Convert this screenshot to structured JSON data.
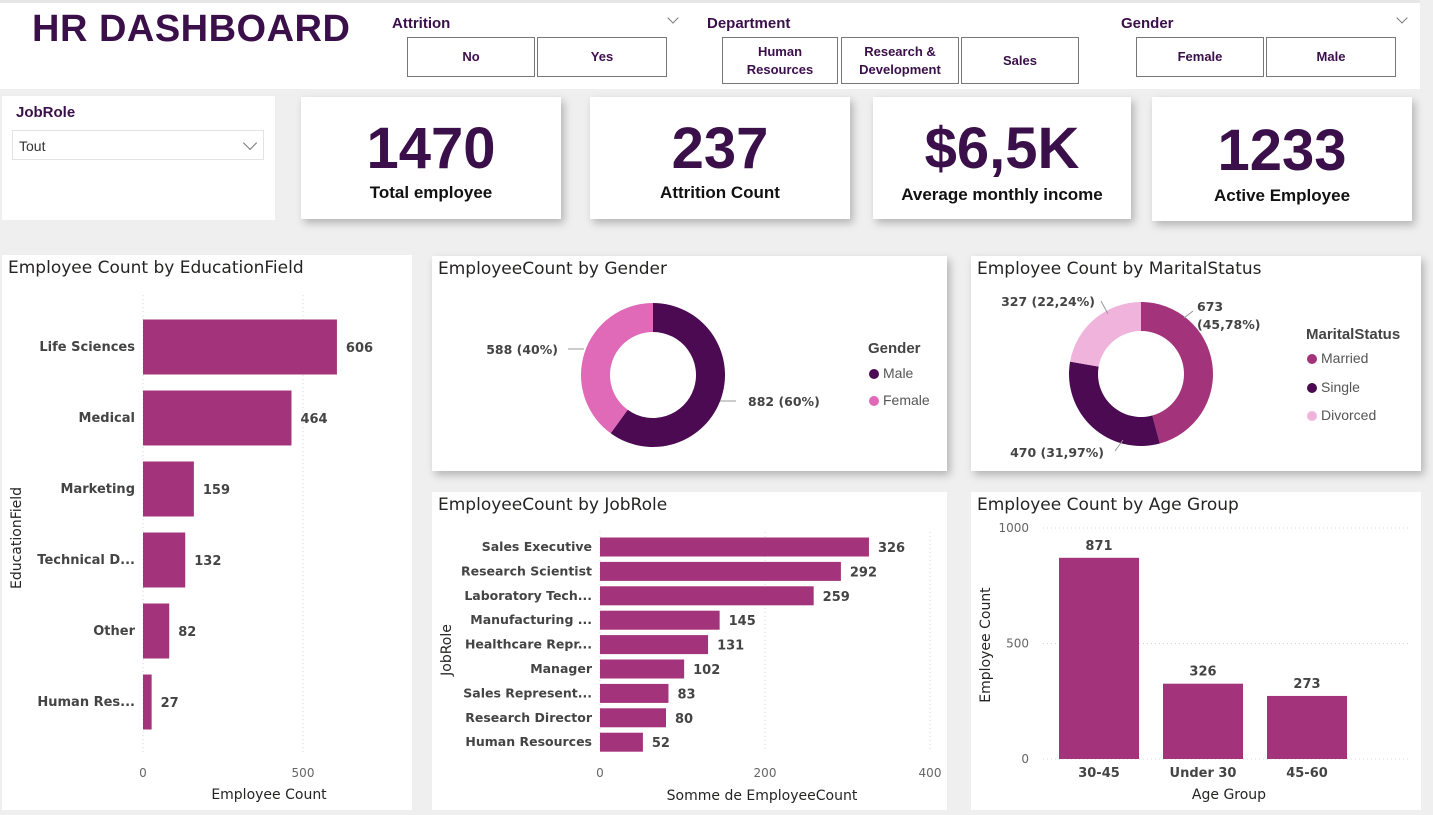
{
  "header": {
    "title": "HR DASHBOARD"
  },
  "filters": {
    "attrition": {
      "label": "Attrition",
      "options": [
        "No",
        "Yes"
      ]
    },
    "department": {
      "label": "Department",
      "options": [
        "Human Resources",
        "Research & Development",
        "Sales"
      ]
    },
    "gender": {
      "label": "Gender",
      "options": [
        "Female",
        "Male"
      ]
    },
    "jobrole": {
      "label": "JobRole",
      "selected": "Tout"
    }
  },
  "kpis": [
    {
      "value": "1470",
      "label": "Total employee"
    },
    {
      "value": "237",
      "label": "Attrition Count"
    },
    {
      "value": "$6,5K",
      "label": "Average monthly income"
    },
    {
      "value": "1233",
      "label": "Active Employee"
    }
  ],
  "colors": {
    "primary": "#a3337a",
    "dark_purple": "#4b0a52",
    "pink": "#e06ab7",
    "light_pink": "#efb3dc",
    "title_purple": "#3a0f4a"
  },
  "chart_data": [
    {
      "type": "bar",
      "orientation": "horizontal",
      "title": "Employee Count by EducationField",
      "xlabel": "Employee Count",
      "ylabel": "EducationField",
      "categories": [
        "Life Sciences",
        "Medical",
        "Marketing",
        "Technical D...",
        "Other",
        "Human Res..."
      ],
      "values": [
        606,
        464,
        159,
        132,
        82,
        27
      ],
      "xticks": [
        "0",
        "500"
      ],
      "xlim": [
        0,
        750
      ]
    },
    {
      "type": "pie",
      "variant": "donut",
      "title": "EmployeeCount by Gender",
      "legend_title": "Gender",
      "slices": [
        {
          "name": "Male",
          "value": 882,
          "label": "882 (60%)",
          "color": "#4b0a52"
        },
        {
          "name": "Female",
          "value": 588,
          "label": "588 (40%)",
          "color": "#e06ab7"
        }
      ]
    },
    {
      "type": "pie",
      "variant": "donut",
      "title": "Employee Count by MaritalStatus",
      "legend_title": "MaritalStatus",
      "slices": [
        {
          "name": "Married",
          "value": 673,
          "label_lines": [
            "673",
            "(45,78%)"
          ],
          "color": "#a3337a"
        },
        {
          "name": "Single",
          "value": 470,
          "label_lines": [
            "470 (31,97%)"
          ],
          "color": "#4b0a52"
        },
        {
          "name": "Divorced",
          "value": 327,
          "label_lines": [
            "327 (22,24%)"
          ],
          "color": "#efb3dc"
        }
      ]
    },
    {
      "type": "bar",
      "orientation": "horizontal",
      "title": "EmployeeCount by JobRole",
      "xlabel": "Somme de EmployeeCount",
      "ylabel": "JobRole",
      "categories": [
        "Sales Executive",
        "Research Scientist",
        "Laboratory Tech...",
        "Manufacturing ...",
        "Healthcare Repr...",
        "Manager",
        "Sales Represent...",
        "Research Director",
        "Human Resources"
      ],
      "values": [
        326,
        292,
        259,
        145,
        131,
        102,
        83,
        80,
        52
      ],
      "xticks": [
        "0",
        "200",
        "400"
      ],
      "xlim": [
        0,
        400
      ]
    },
    {
      "type": "bar",
      "orientation": "vertical",
      "title": "Employee Count by Age Group",
      "xlabel": "Age Group",
      "ylabel": "Employee Count",
      "categories": [
        "30-45",
        "Under 30",
        "45-60"
      ],
      "values": [
        871,
        326,
        273
      ],
      "yticks": [
        "0",
        "500",
        "1000"
      ],
      "ylim": [
        0,
        1000
      ]
    }
  ]
}
